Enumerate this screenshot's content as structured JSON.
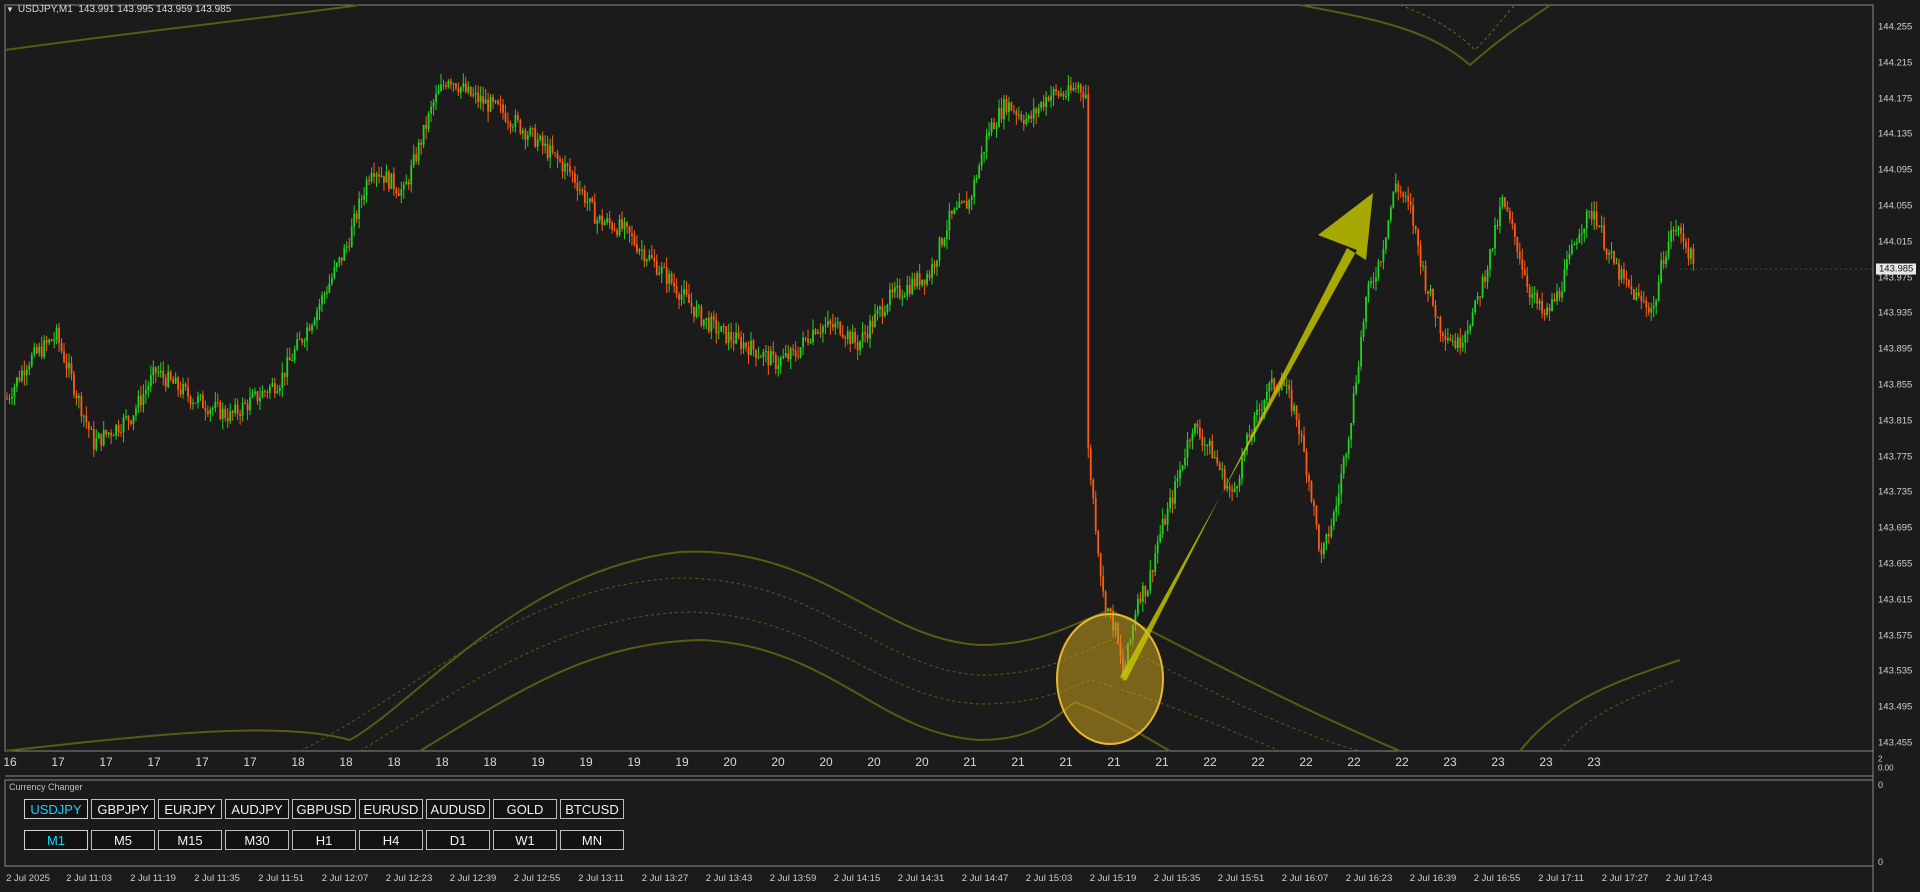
{
  "symbol_header": {
    "symbol_timeframe": "USDJPY,M1",
    "ohlc": "143.991 143.995 143.959 143.985"
  },
  "price_axis": {
    "labels": [
      "144.255",
      "144.215",
      "144.175",
      "144.135",
      "144.095",
      "144.055",
      "144.015",
      "143.975",
      "143.935",
      "143.895",
      "143.855",
      "143.815",
      "143.775",
      "143.735",
      "143.695",
      "143.655",
      "143.615",
      "143.575",
      "143.535",
      "143.495",
      "143.455"
    ],
    "current_price": "143.985"
  },
  "hour_axis": {
    "labels": [
      "16",
      "17",
      "17",
      "17",
      "17",
      "17",
      "18",
      "18",
      "18",
      "18",
      "18",
      "19",
      "19",
      "19",
      "19",
      "20",
      "20",
      "20",
      "20",
      "20",
      "21",
      "21",
      "21",
      "21",
      "21",
      "22",
      "22",
      "22",
      "22",
      "22",
      "23",
      "23",
      "23",
      "23"
    ]
  },
  "indicator_window": {
    "title": "Currency Changer",
    "symbol_buttons": [
      "USDJPY",
      "GBPJPY",
      "EURJPY",
      "AUDJPY",
      "GBPUSD",
      "EURUSD",
      "AUDUSD",
      "GOLD",
      "BTCUSD"
    ],
    "active_symbol": "USDJPY",
    "timeframe_buttons": [
      "M1",
      "M5",
      "M15",
      "M30",
      "H1",
      "H4",
      "D1",
      "W1",
      "MN"
    ],
    "active_timeframe": "M1",
    "axis_labels": {
      "top": "0",
      "bottom": "0",
      "splitter_top": "2",
      "splitter_bottom": "0.00"
    }
  },
  "time_axis": {
    "labels": [
      "2 Jul 2025",
      "2 Jul 11:03",
      "2 Jul 11:19",
      "2 Jul 11:35",
      "2 Jul 11:51",
      "2 Jul 12:07",
      "2 Jul 12:23",
      "2 Jul 12:39",
      "2 Jul 12:55",
      "2 Jul 13:11",
      "2 Jul 13:27",
      "2 Jul 13:43",
      "2 Jul 13:59",
      "2 Jul 14:15",
      "2 Jul 14:31",
      "2 Jul 14:47",
      "2 Jul 15:03",
      "2 Jul 15:19",
      "2 Jul 15:35",
      "2 Jul 15:51",
      "2 Jul 16:07",
      "2 Jul 16:23",
      "2 Jul 16:39",
      "2 Jul 16:55",
      "2 Jul 17:11",
      "2 Jul 17:27",
      "2 Jul 17:43"
    ]
  },
  "chart_data": {
    "type": "candlestick",
    "symbol": "USDJPY",
    "timeframe": "M1",
    "ylim": [
      143.44,
      144.27
    ],
    "up_color": "#22d322",
    "down_color": "#ff5a14",
    "close_path": [
      [
        0,
        143.84
      ],
      [
        8,
        143.88
      ],
      [
        20,
        143.91
      ],
      [
        35,
        143.79
      ],
      [
        50,
        143.82
      ],
      [
        60,
        143.87
      ],
      [
        75,
        143.84
      ],
      [
        90,
        143.82
      ],
      [
        100,
        143.84
      ],
      [
        110,
        143.86
      ],
      [
        125,
        143.94
      ],
      [
        137,
        144.01
      ],
      [
        147,
        144.1
      ],
      [
        160,
        144.07
      ],
      [
        172,
        144.17
      ],
      [
        178,
        144.2
      ],
      [
        186,
        144.18
      ],
      [
        200,
        144.16
      ],
      [
        213,
        144.13
      ],
      [
        228,
        144.09
      ],
      [
        238,
        144.04
      ],
      [
        248,
        144.03
      ],
      [
        258,
        144.0
      ],
      [
        268,
        143.97
      ],
      [
        280,
        143.93
      ],
      [
        290,
        143.91
      ],
      [
        298,
        143.9
      ],
      [
        310,
        143.88
      ],
      [
        318,
        143.89
      ],
      [
        326,
        143.92
      ],
      [
        336,
        143.92
      ],
      [
        343,
        143.9
      ],
      [
        355,
        143.95
      ],
      [
        366,
        143.97
      ],
      [
        372,
        143.98
      ],
      [
        380,
        144.04
      ],
      [
        388,
        144.06
      ],
      [
        396,
        144.14
      ],
      [
        403,
        144.17
      ],
      [
        412,
        144.15
      ],
      [
        420,
        144.18
      ],
      [
        428,
        144.18
      ],
      [
        432,
        144.19
      ],
      [
        435,
        144.18
      ],
      [
        436,
        143.78
      ],
      [
        442,
        143.62
      ],
      [
        447,
        143.58
      ],
      [
        450,
        143.53
      ],
      [
        453,
        143.57
      ],
      [
        456,
        143.62
      ],
      [
        460,
        143.63
      ],
      [
        464,
        143.68
      ],
      [
        470,
        143.73
      ],
      [
        478,
        143.81
      ],
      [
        486,
        143.78
      ],
      [
        494,
        143.73
      ],
      [
        500,
        143.79
      ],
      [
        508,
        143.85
      ],
      [
        514,
        143.86
      ],
      [
        520,
        143.82
      ],
      [
        525,
        143.75
      ],
      [
        530,
        143.66
      ],
      [
        536,
        143.72
      ],
      [
        542,
        143.82
      ],
      [
        548,
        143.95
      ],
      [
        554,
        144.0
      ],
      [
        560,
        144.08
      ],
      [
        566,
        144.05
      ],
      [
        572,
        143.97
      ],
      [
        578,
        143.92
      ],
      [
        585,
        143.9
      ],
      [
        592,
        143.94
      ],
      [
        598,
        144.0
      ],
      [
        603,
        144.06
      ],
      [
        608,
        144.02
      ],
      [
        614,
        143.96
      ],
      [
        620,
        143.93
      ],
      [
        626,
        143.96
      ],
      [
        634,
        144.03
      ],
      [
        640,
        144.05
      ],
      [
        646,
        144.0
      ],
      [
        652,
        143.97
      ],
      [
        658,
        143.95
      ],
      [
        664,
        143.94
      ],
      [
        668,
        144.0
      ],
      [
        672,
        144.03
      ],
      [
        676,
        144.02
      ],
      [
        680,
        143.99
      ]
    ]
  }
}
